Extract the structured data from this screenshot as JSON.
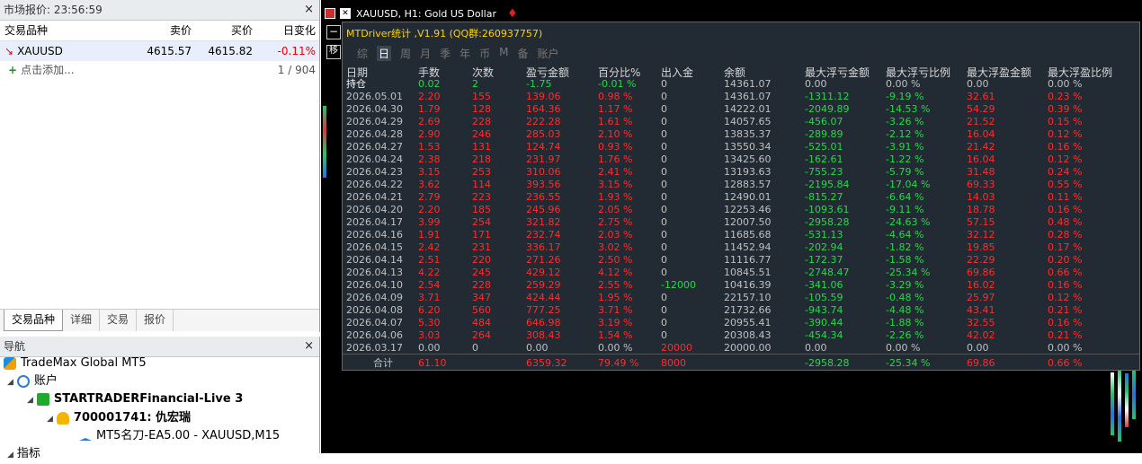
{
  "market_watch": {
    "title": "市场报价: 23:56:59",
    "close": "×",
    "columns": [
      "交易品种",
      "卖价",
      "买价",
      "日变化"
    ],
    "row": {
      "symbol": "XAUUSD",
      "bid": "4615.57",
      "ask": "4615.82",
      "change": "-0.11%"
    },
    "add_label": "点击添加...",
    "count": "1 / 904",
    "tabs": [
      "交易品种",
      "详细",
      "交易",
      "报价"
    ]
  },
  "navigator": {
    "title": "导航",
    "close": "×",
    "broker": "TradeMax Global MT5",
    "accounts": "账户",
    "server": "STARTRADERFinancial-Live 3",
    "account": "700001741: 仇宏瑞",
    "ea": "MT5名刀-EA5.00 - XAUUSD,M15",
    "next": "指标"
  },
  "chart": {
    "title": "XAUUSD, H1:  Gold US Dollar"
  },
  "stats": {
    "title": "MTDriver统计 ,V1.91 (QQ群:260937757)",
    "side_button": "移",
    "tabs": [
      "综",
      "日",
      "周",
      "月",
      "季",
      "年",
      "币",
      "M",
      "备",
      "账户"
    ],
    "active_tab": "日",
    "headers": [
      "日期",
      "手数",
      "次数",
      "盈亏金额",
      "百分比%",
      "出入金",
      "余额",
      "最大浮亏金额",
      "最大浮亏比例",
      "最大浮盈金额",
      "最大浮盈比例"
    ],
    "holding": [
      "持仓",
      "0.02",
      "2",
      "-1.75",
      "-0.01 %",
      "0",
      "14361.07",
      "0.00",
      "0.00 %",
      "0.00",
      "0.00 %"
    ],
    "rows": [
      [
        "2026.05.01",
        "2.20",
        "155",
        "139.06",
        "0.98 %",
        "0",
        "14361.07",
        "-1311.12",
        "-9.19 %",
        "32.61",
        "0.23 %"
      ],
      [
        "2026.04.30",
        "1.79",
        "128",
        "164.36",
        "1.17 %",
        "0",
        "14222.01",
        "-2049.89",
        "-14.53 %",
        "54.29",
        "0.39 %"
      ],
      [
        "2026.04.29",
        "2.69",
        "228",
        "222.28",
        "1.61 %",
        "0",
        "14057.65",
        "-456.07",
        "-3.26 %",
        "21.52",
        "0.15 %"
      ],
      [
        "2026.04.28",
        "2.90",
        "246",
        "285.03",
        "2.10 %",
        "0",
        "13835.37",
        "-289.89",
        "-2.12 %",
        "16.04",
        "0.12 %"
      ],
      [
        "2026.04.27",
        "1.53",
        "131",
        "124.74",
        "0.93 %",
        "0",
        "13550.34",
        "-525.01",
        "-3.91 %",
        "21.42",
        "0.16 %"
      ],
      [
        "2026.04.24",
        "2.38",
        "218",
        "231.97",
        "1.76 %",
        "0",
        "13425.60",
        "-162.61",
        "-1.22 %",
        "16.04",
        "0.12 %"
      ],
      [
        "2026.04.23",
        "3.15",
        "253",
        "310.06",
        "2.41 %",
        "0",
        "13193.63",
        "-755.23",
        "-5.79 %",
        "31.48",
        "0.24 %"
      ],
      [
        "2026.04.22",
        "3.62",
        "114",
        "393.56",
        "3.15 %",
        "0",
        "12883.57",
        "-2195.84",
        "-17.04 %",
        "69.33",
        "0.55 %"
      ],
      [
        "2026.04.21",
        "2.79",
        "223",
        "236.55",
        "1.93 %",
        "0",
        "12490.01",
        "-815.27",
        "-6.64 %",
        "14.03",
        "0.11 %"
      ],
      [
        "2026.04.20",
        "2.20",
        "185",
        "245.96",
        "2.05 %",
        "0",
        "12253.46",
        "-1093.61",
        "-9.11 %",
        "18.78",
        "0.16 %"
      ],
      [
        "2026.04.17",
        "3.99",
        "254",
        "321.82",
        "2.75 %",
        "0",
        "12007.50",
        "-2958.28",
        "-24.63 %",
        "57.15",
        "0.48 %"
      ],
      [
        "2026.04.16",
        "1.91",
        "171",
        "232.74",
        "2.03 %",
        "0",
        "11685.68",
        "-531.13",
        "-4.64 %",
        "32.12",
        "0.28 %"
      ],
      [
        "2026.04.15",
        "2.42",
        "231",
        "336.17",
        "3.02 %",
        "0",
        "11452.94",
        "-202.94",
        "-1.82 %",
        "19.85",
        "0.17 %"
      ],
      [
        "2026.04.14",
        "2.51",
        "220",
        "271.26",
        "2.50 %",
        "0",
        "11116.77",
        "-172.37",
        "-1.58 %",
        "22.29",
        "0.20 %"
      ],
      [
        "2026.04.13",
        "4.22",
        "245",
        "429.12",
        "4.12 %",
        "0",
        "10845.51",
        "-2748.47",
        "-25.34 %",
        "69.86",
        "0.66 %"
      ],
      [
        "2026.04.10",
        "2.54",
        "228",
        "259.29",
        "2.55 %",
        "-12000",
        "10416.39",
        "-341.06",
        "-3.29 %",
        "16.02",
        "0.16 %"
      ],
      [
        "2026.04.09",
        "3.71",
        "347",
        "424.44",
        "1.95 %",
        "0",
        "22157.10",
        "-105.59",
        "-0.48 %",
        "25.97",
        "0.12 %"
      ],
      [
        "2026.04.08",
        "6.20",
        "560",
        "777.25",
        "3.71 %",
        "0",
        "21732.66",
        "-943.74",
        "-4.48 %",
        "43.41",
        "0.21 %"
      ],
      [
        "2026.04.07",
        "5.30",
        "484",
        "646.98",
        "3.19 %",
        "0",
        "20955.41",
        "-390.44",
        "-1.88 %",
        "32.55",
        "0.16 %"
      ],
      [
        "2026.04.06",
        "3.03",
        "264",
        "308.43",
        "1.54 %",
        "0",
        "20308.43",
        "-454.34",
        "-2.26 %",
        "42.02",
        "0.21 %"
      ],
      [
        "2026.03.17",
        "0.00",
        "0",
        "0.00",
        "0.00 %",
        "20000",
        "20000.00",
        "0.00",
        "0.00 %",
        "0.00",
        "0.00 %"
      ]
    ],
    "total": [
      "合计",
      "61.10",
      "",
      "6359.32",
      "79.49 %",
      "8000",
      "",
      "-2958.28",
      "-25.34 %",
      "69.86",
      "0.66 %"
    ],
    "colors": {
      "positive": "#27d84a",
      "negative": "#ff2d2d",
      "title": "#ffd400",
      "background": "#222a33"
    }
  }
}
